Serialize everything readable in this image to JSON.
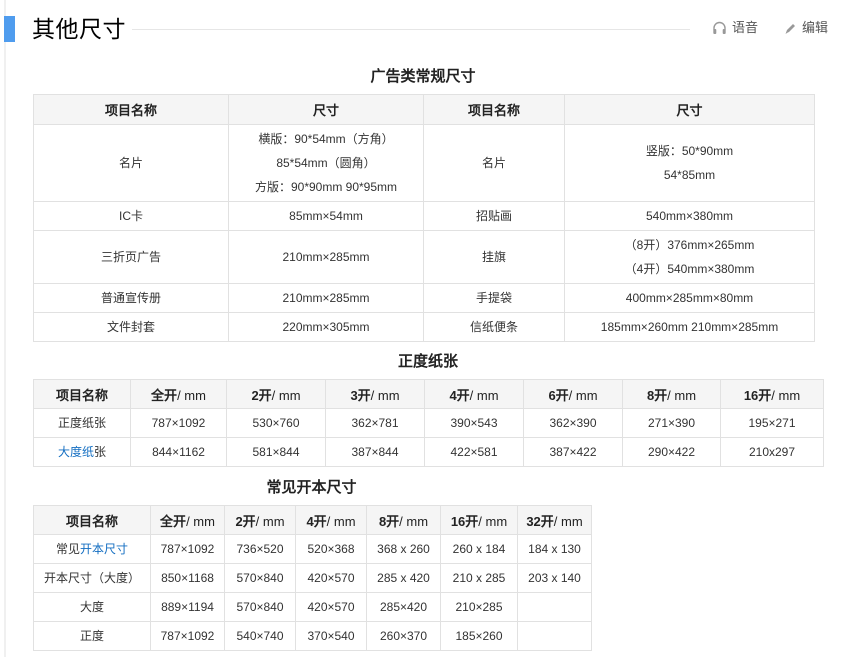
{
  "page": {
    "title": "其他尺寸",
    "voice_label": "语音",
    "edit_label": "编辑"
  },
  "ad_table": {
    "caption": "广告类常规尺寸",
    "headers": [
      "项目名称",
      "尺寸",
      "项目名称",
      "尺寸"
    ],
    "rows": [
      {
        "name1": "名片",
        "size1": [
          "横版：90*54mm（方角）",
          "85*54mm（圆角）",
          "方版：90*90mm 90*95mm"
        ],
        "name2": "名片",
        "size2": [
          "竖版：50*90mm",
          "54*85mm"
        ]
      },
      {
        "name1": "IC卡",
        "size1": [
          "85mm×54mm"
        ],
        "name2": "招贴画",
        "size2": [
          "540mm×380mm"
        ]
      },
      {
        "name1": "三折页广告",
        "size1": [
          "210mm×285mm"
        ],
        "name2": "挂旗",
        "size2": [
          "（8开）376mm×265mm",
          "（4开）540mm×380mm"
        ]
      },
      {
        "name1": "普通宣传册",
        "size1": [
          "210mm×285mm"
        ],
        "name2": "手提袋",
        "size2": [
          "400mm×285mm×80mm"
        ]
      },
      {
        "name1": "文件封套",
        "size1": [
          "220mm×305mm"
        ],
        "name2": "信纸便条",
        "size2": [
          "185mm×260mm 210mm×285mm"
        ]
      }
    ]
  },
  "paper_table": {
    "caption": "正度纸张",
    "headers": [
      {
        "b": "项目名称",
        "r": ""
      },
      {
        "b": "全开",
        "r": "/ mm"
      },
      {
        "b": "2开",
        "r": "/ mm"
      },
      {
        "b": "3开",
        "r": "/ mm"
      },
      {
        "b": "4开",
        "r": "/ mm"
      },
      {
        "b": "6开",
        "r": "/ mm"
      },
      {
        "b": "8开",
        "r": "/ mm"
      },
      {
        "b": "16开",
        "r": "/ mm"
      }
    ],
    "rows": [
      {
        "name_pre": "正度纸张",
        "name_link": "",
        "name_post": "",
        "cells": [
          "787×1092",
          "530×760",
          "362×781",
          "390×543",
          "362×390",
          "271×390",
          "195×271"
        ]
      },
      {
        "name_pre": "",
        "name_link": "大度纸",
        "name_post": "张",
        "cells": [
          "844×1162",
          "581×844",
          "387×844",
          "422×581",
          "387×422",
          "290×422",
          "210x297"
        ]
      }
    ]
  },
  "format_table": {
    "caption": "常见开本尺寸",
    "headers": [
      {
        "b": "项目名称",
        "r": ""
      },
      {
        "b": "全开",
        "r": "/ mm"
      },
      {
        "b": "2开",
        "r": "/ mm"
      },
      {
        "b": "4开",
        "r": "/ mm"
      },
      {
        "b": "8开",
        "r": "/ mm"
      },
      {
        "b": "16开",
        "r": "/ mm"
      },
      {
        "b": "32开",
        "r": "/ mm"
      }
    ],
    "rows": [
      {
        "name_pre": "常见",
        "name_link": "开本尺寸",
        "name_post": "",
        "cells": [
          "787×1092",
          "736×520",
          "520×368",
          "368 x 260",
          "260 x 184",
          "184 x 130"
        ]
      },
      {
        "name_pre": "开本尺寸（大度）",
        "name_link": "",
        "name_post": "",
        "cells": [
          "850×1168",
          "570×840",
          "420×570",
          "285 x 420",
          "210 x 285",
          "203 x 140"
        ]
      },
      {
        "name_pre": "大度",
        "name_link": "",
        "name_post": "",
        "cells": [
          "889×1194",
          "570×840",
          "420×570",
          "285×420",
          "210×285",
          ""
        ]
      },
      {
        "name_pre": "正度",
        "name_link": "",
        "name_post": "",
        "cells": [
          "787×1092",
          "540×740",
          "370×540",
          "260×370",
          "185×260",
          ""
        ]
      }
    ]
  }
}
